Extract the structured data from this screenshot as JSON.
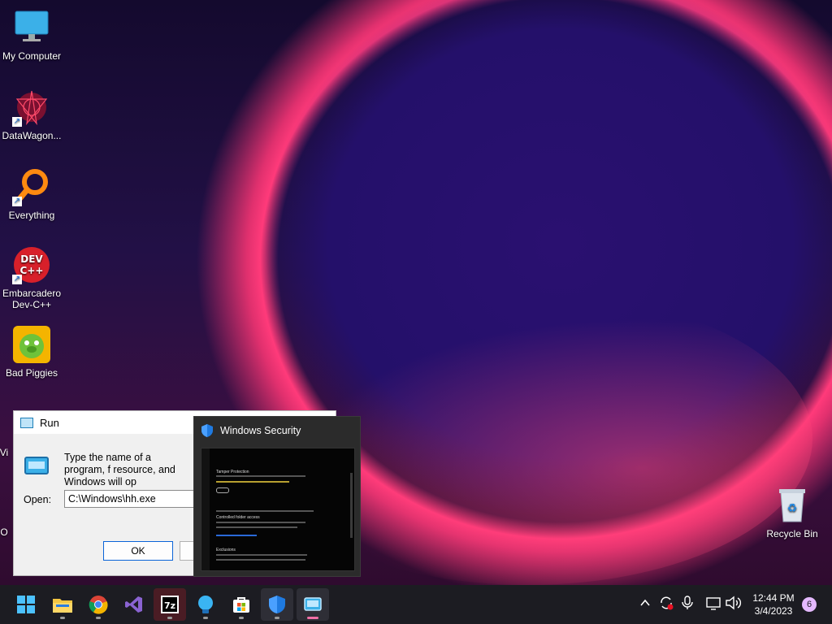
{
  "desktop": {
    "icons": [
      {
        "label": "My Computer"
      },
      {
        "label": "DataWagon..."
      },
      {
        "label": "Everything"
      },
      {
        "label": "Embarcadero Dev-C++"
      },
      {
        "label": "Bad Piggies"
      },
      {
        "label": "Vi"
      },
      {
        "label": "O"
      },
      {
        "label": "Recycle Bin"
      }
    ]
  },
  "run_dialog": {
    "title": "Run",
    "description": "Type the name of a program, f resource, and Windows will op",
    "open_label": "Open:",
    "open_value": "C:\\Windows\\hh.exe",
    "ok_label": "OK"
  },
  "windows_security_preview": {
    "title": "Windows Security",
    "thumb_sections": [
      "Tamper Protection",
      "Controlled folder access",
      "Exclusions"
    ]
  },
  "taskbar": {
    "apps": [
      "start-icon",
      "file-explorer-icon",
      "chrome-icon",
      "visual-studio-icon",
      "7zip-icon",
      "tips-icon",
      "microsoft-store-icon",
      "windows-security-icon",
      "run-icon"
    ],
    "time": "12:44 PM",
    "date": "3/4/2023",
    "notification_count": "6"
  },
  "colors": {
    "accent": "#0a64d8",
    "taskbar_bg": "#1c1c22",
    "security_blue": "#1f7ae0"
  }
}
